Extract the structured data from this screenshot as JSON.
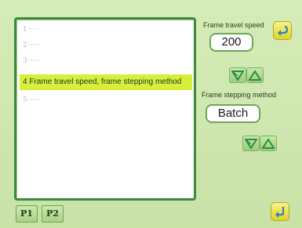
{
  "list": {
    "items": [
      {
        "label": "1·····"
      },
      {
        "label": "2·····"
      },
      {
        "label": "3·····"
      },
      {
        "label": "4 Frame travel speed, frame stepping method"
      },
      {
        "label": "5·····"
      }
    ]
  },
  "frame_travel_speed": {
    "label": "Frame travel speed",
    "value": "200"
  },
  "frame_stepping_method": {
    "label": "Frame stepping method",
    "value": "Batch"
  },
  "tabs": [
    {
      "label": "P1"
    },
    {
      "label": "P2"
    }
  ],
  "colors": {
    "background": "#cfe6b0",
    "panel_border": "#3c8a3c",
    "selected_row": "#d7ee3a",
    "arrow": "#2a8a55",
    "yellow_button": "#e8df40"
  },
  "icons": {
    "top_right": "return-arrow-icon",
    "bottom_right": "enter-arrow-icon",
    "down": "triangle-down-icon",
    "up": "triangle-up-icon"
  }
}
